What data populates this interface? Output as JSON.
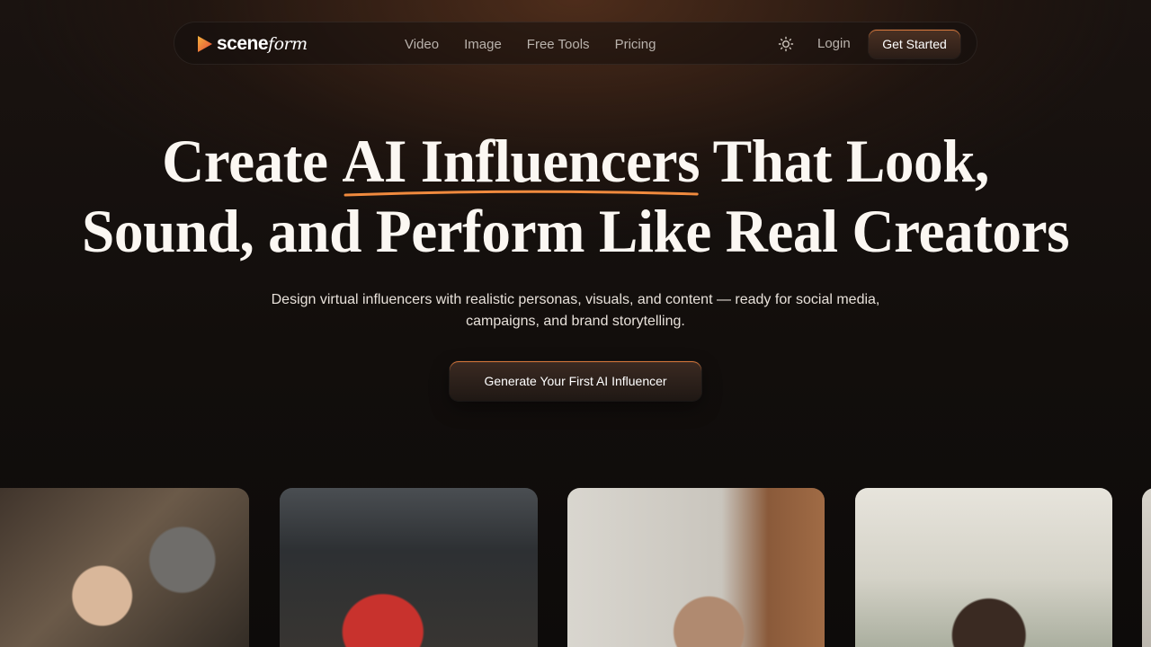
{
  "nav": {
    "logo": {
      "scene": "scene",
      "form": "form"
    },
    "links": [
      "Video",
      "Image",
      "Free Tools",
      "Pricing"
    ],
    "theme_icon": "sun-icon",
    "login": "Login",
    "cta": "Get Started"
  },
  "hero": {
    "headline_line1_pre": "Create ",
    "headline_highlight": "AI Influencers",
    "headline_line1_post": " That Look,",
    "headline_line2": "Sound, and Perform Like Real Creators",
    "subtitle": "Design virtual influencers with realistic personas, visuals, and content — ready for social media, campaigns, and brand storytelling.",
    "cta": "Generate Your First AI Influencer"
  },
  "colors": {
    "accent": "#f08a3e",
    "accent_gradient_start": "#f4a13b",
    "accent_gradient_end": "#e4473a",
    "background": "#120e0c",
    "text": "#fbf7f2"
  },
  "gallery": {
    "cards": [
      {
        "icon": "video-thumbnail-icon"
      },
      {
        "icon": "video-thumbnail-icon"
      },
      {
        "icon": "video-thumbnail-icon"
      },
      {
        "icon": "video-thumbnail-icon"
      },
      {
        "icon": "video-thumbnail-icon"
      }
    ]
  }
}
